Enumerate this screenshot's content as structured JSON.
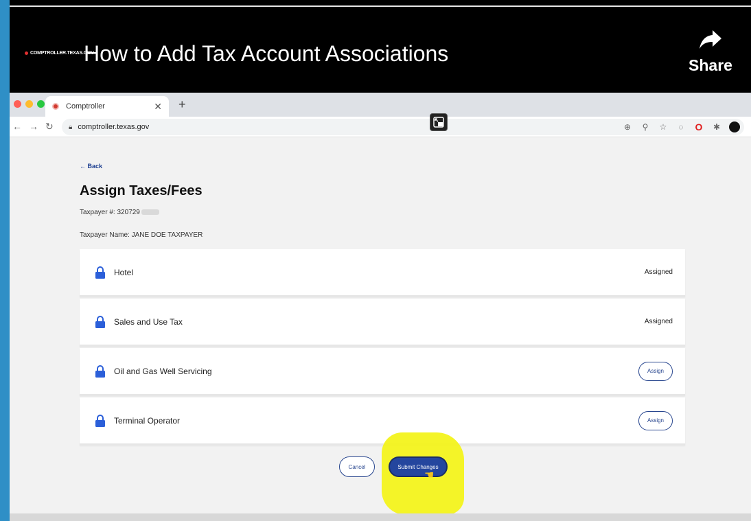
{
  "video": {
    "logo_text": "COMPTROLLER.TEXAS.GOV",
    "title": "How to Add Tax Account Associations",
    "share_label": "Share"
  },
  "browser": {
    "tab_title": "Comptroller",
    "url": "comptroller.texas.gov"
  },
  "page": {
    "back_label": "Back",
    "title": "Assign Taxes/Fees",
    "taxpayer_number": "Taxpayer #: 320729",
    "taxpayer_name": "Taxpayer Name: JANE DOE TAXPAYER",
    "taxes": [
      {
        "name": "Hotel",
        "status": "Assigned"
      },
      {
        "name": "Sales and Use Tax",
        "status": "Assigned"
      },
      {
        "name": "Oil and Gas Well Servicing",
        "action": "Assign"
      },
      {
        "name": "Terminal Operator",
        "action": "Assign"
      }
    ],
    "cancel_label": "Cancel",
    "submit_label": "Submit Changes"
  },
  "colors": {
    "lock_icon": "#2b5fd9",
    "primary_button": "#24469e",
    "highlight": "#f3f31c",
    "outer_background": "#2f8fc6"
  }
}
